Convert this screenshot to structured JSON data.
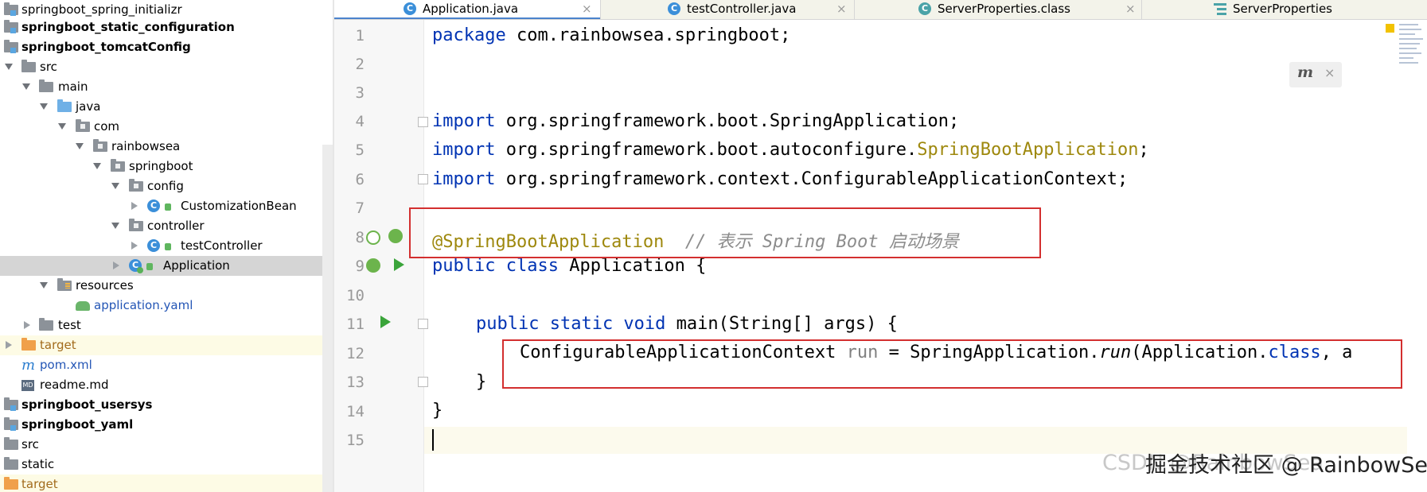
{
  "project_tree": {
    "rows": [
      {
        "label": "springboot_spring_initializr",
        "bold": false
      },
      {
        "label": "springboot_static_configuration",
        "bold": true
      },
      {
        "label": "springboot_tomcatConfig",
        "bold": true
      },
      {
        "label": "src"
      },
      {
        "label": "main"
      },
      {
        "label": "java"
      },
      {
        "label": "com"
      },
      {
        "label": "rainbowsea"
      },
      {
        "label": "springboot"
      },
      {
        "label": "config"
      },
      {
        "label": "CustomizationBean"
      },
      {
        "label": "controller"
      },
      {
        "label": "testController"
      },
      {
        "label": "Application",
        "selected": true
      },
      {
        "label": "resources"
      },
      {
        "label": "application.yaml"
      },
      {
        "label": "test"
      },
      {
        "label": "target",
        "excluded": true
      },
      {
        "label": "pom.xml"
      },
      {
        "label": "readme.md"
      },
      {
        "label": "springboot_usersys",
        "bold": true
      },
      {
        "label": "springboot_yaml",
        "bold": true
      },
      {
        "label": "src"
      },
      {
        "label": "static"
      },
      {
        "label": "target",
        "excluded": true
      }
    ]
  },
  "tabs": [
    {
      "label": "Application.java",
      "icon": "class-icon",
      "active": true
    },
    {
      "label": "testController.java",
      "icon": "class-icon"
    },
    {
      "label": "ServerProperties.class",
      "icon": "class-icon"
    },
    {
      "label": "ServerProperties",
      "icon": "structure-icon"
    }
  ],
  "tab_close_glyph": "×",
  "editor": {
    "line_numbers": [
      "1",
      "2",
      "3",
      "4",
      "5",
      "6",
      "7",
      "8",
      "9",
      "10",
      "11",
      "12",
      "13",
      "14",
      "15"
    ],
    "code": {
      "l1_kw": "package",
      "l1_rest": " com.rainbowsea.springboot;",
      "l4_kw": "import",
      "l4_rest": " org.springframework.boot.SpringApplication;",
      "l5_kw": "import",
      "l5_pre": " org.springframework.boot.autoconfigure.",
      "l5_ann": "SpringBootApplication",
      "l5_end": ";",
      "l6_kw": "import",
      "l6_rest": " org.springframework.context.ConfigurableApplicationContext;",
      "l8_ann": "@SpringBootApplication",
      "l8_cmt": "  // 表示 Spring Boot 启动场景",
      "l9_kw": "public class",
      "l9_rest": " Application {",
      "l11_kw": "public static void",
      "l11_rest": " main(String[] args) {",
      "l12_type": "ConfigurableApplicationContext ",
      "l12_var": "run",
      "l12_mid": " = SpringApplication.",
      "l12_call": "run",
      "l12_args": "(Application.",
      "l12_kw": "class",
      "l12_tail": ", a",
      "l13": "}",
      "l14": "}"
    },
    "inspection_close": "×"
  },
  "watermark": {
    "back_text": "CSDN @RainbowSea",
    "front_text": "掘金技术社区 @ RainbowSea"
  },
  "colors": {
    "keyword": "#0033b3",
    "annotation": "#9e880d",
    "comment": "#8c8c8c",
    "highlight_box": "#d32f2f"
  }
}
